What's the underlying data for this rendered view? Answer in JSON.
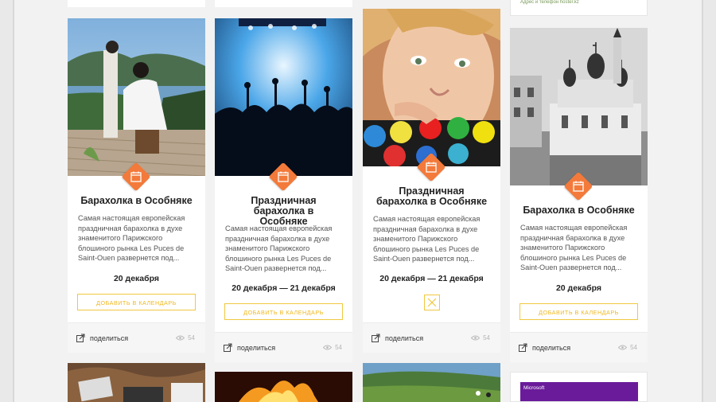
{
  "header": {
    "address_text": "Адрес и телефон  hoster.kz"
  },
  "cards": [
    {
      "title": "Барахолка в Особняке",
      "description": "Самая настоящая европейская праздничная барахолка в духе знаменитого Парижского блошиного рынка Les Puces de Saint-Ouen развернется под...",
      "date": "20 декабря",
      "button": "ДОБАВИТЬ В КАЛЕНДАРЬ",
      "share": "поделиться",
      "views": "54"
    },
    {
      "title": "Праздничная барахолка в Особняке",
      "description": "Самая настоящая европейская праздничная барахолка в духе знаменитого Парижского блошиного рынка Les Puces de Saint-Ouen развернется под...",
      "date": "20 декабря — 21 декабря",
      "button": "ДОБАВИТЬ В КАЛЕНДАРЬ",
      "share": "поделиться",
      "views": "54"
    },
    {
      "title": "Праздничная барахолка в Особняке",
      "description": "Самая настоящая европейская праздничная барахолка в духе знаменитого Парижского блошиного рынка Les Puces de Saint-Ouen развернется под...",
      "date": "20 декабря — 21 декабря",
      "share": "поделиться",
      "views": "54"
    },
    {
      "title": "Барахолка в Особняке",
      "description": "Самая настоящая европейская праздничная барахолка в духе знаменитого Парижского блошиного рынка Les Puces de Saint-Ouen развернется под...",
      "date": "20 декабря",
      "button": "ДОБАВИТЬ В КАЛЕНДАРЬ",
      "share": "поделиться",
      "views": "54"
    }
  ],
  "ad": {
    "brand": "Microsoft"
  },
  "colors": {
    "accent": "#f37a3a",
    "button_border": "#f0c840",
    "button_text": "#f0b820",
    "ad_bg": "#6a1b9a"
  }
}
